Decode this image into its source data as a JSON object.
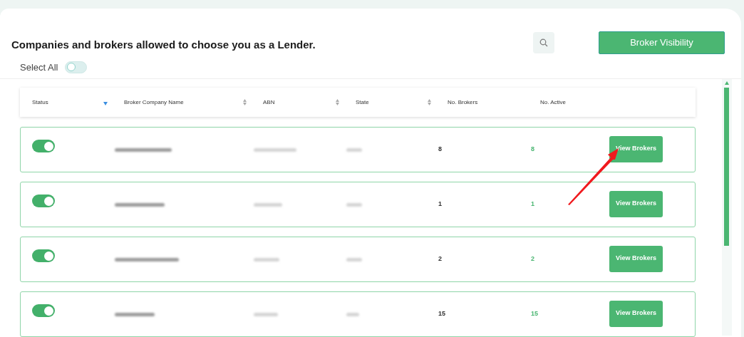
{
  "header": {
    "title": "Companies and brokers allowed to choose you as a Lender.",
    "visibility_button": "Broker Visibility",
    "select_all": {
      "label": "Select All",
      "on": false
    }
  },
  "table": {
    "columns": [
      {
        "label": "Status",
        "sorted": true
      },
      {
        "label": "Broker Company Name",
        "sorted": false
      },
      {
        "label": "ABN",
        "sorted": false
      },
      {
        "label": "State",
        "sorted": false
      },
      {
        "label": "No. Brokers"
      },
      {
        "label": "No. Active"
      }
    ],
    "rows": [
      {
        "on": true,
        "brokers": "8",
        "active": "8",
        "action": "View Brokers"
      },
      {
        "on": true,
        "brokers": "1",
        "active": "1",
        "action": "View Brokers"
      },
      {
        "on": true,
        "brokers": "2",
        "active": "2",
        "action": "View Brokers"
      },
      {
        "on": true,
        "brokers": "15",
        "active": "15",
        "action": "View Brokers"
      }
    ]
  }
}
